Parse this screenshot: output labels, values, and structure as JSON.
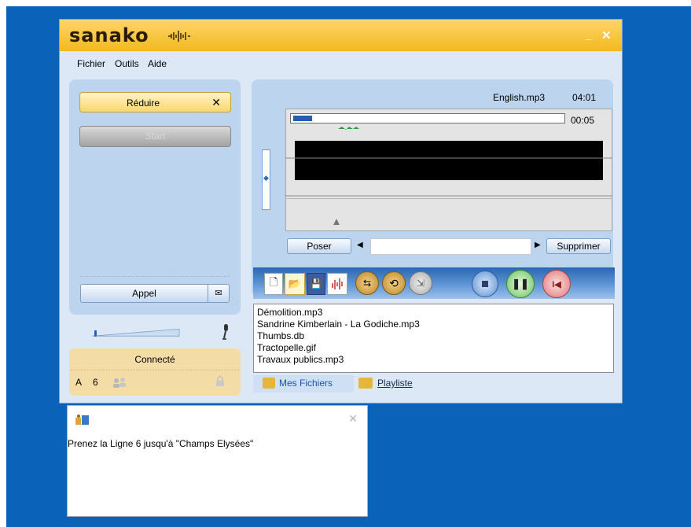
{
  "app": {
    "title": "sanako"
  },
  "window_controls": {
    "minimize": "_",
    "close": "✕"
  },
  "menu": [
    "Fichier",
    "Outils",
    "Aide"
  ],
  "left": {
    "reduce_label": "Réduire",
    "reduce_close": "✕",
    "disabled_label": "Start",
    "call_label": "Appel"
  },
  "status": {
    "connected": "Connecté",
    "group": "A",
    "line": "6"
  },
  "player": {
    "file_name": "English.mp3",
    "duration": "04:01",
    "position": "00:05",
    "progress": 0.07,
    "pose_label": "Poser",
    "delete_label": "Supprimer",
    "comment_value": ""
  },
  "files": [
    "Démolition.mp3",
    "Sandrine Kimberlain - La Godiche.mp3",
    "Thumbs.db",
    "Tractopelle.gif",
    "Travaux publics.mp3"
  ],
  "tabs": {
    "my_files": "Mes Fichiers",
    "playlist": "Playliste"
  },
  "notification": {
    "text": "Prenez la Ligne 6 jusqu'à \"Champs Elysées\"",
    "close": "✕"
  },
  "colors": {
    "desktop": "#0a63b8",
    "titlebar": "#f2b820",
    "panel": "#bcd4ee",
    "status": "#f4dca6",
    "progress": "#1f5fad"
  }
}
